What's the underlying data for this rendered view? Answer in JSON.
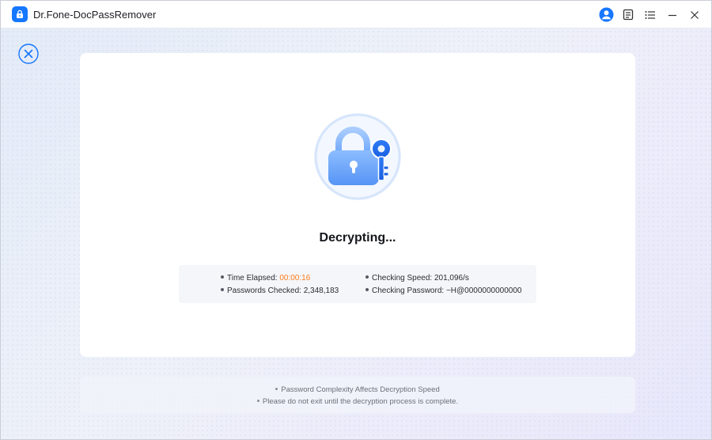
{
  "window": {
    "title": "Dr.Fone-DocPassRemover"
  },
  "titlebar": {
    "icons": [
      "user-icon",
      "feedback-icon",
      "menu-icon",
      "minimize-icon",
      "close-icon"
    ]
  },
  "main": {
    "heading": "Decrypting...",
    "stats": {
      "time_elapsed_label": "Time Elapsed:",
      "time_elapsed_value": "00:00:16",
      "checking_speed_label": "Checking Speed:",
      "checking_speed_value": "201,096/s",
      "passwords_checked_label": "Passwords Checked:",
      "passwords_checked_value": "2,348,183",
      "checking_password_label": "Checking Password:",
      "checking_password_value": "~H@0000000000000"
    }
  },
  "notes": {
    "items": [
      "Password Complexity Affects Decryption Speed",
      "Please do not exit until the decryption process is complete."
    ]
  },
  "colors": {
    "accent": "#1677ff",
    "highlight": "#ff7a1a"
  }
}
